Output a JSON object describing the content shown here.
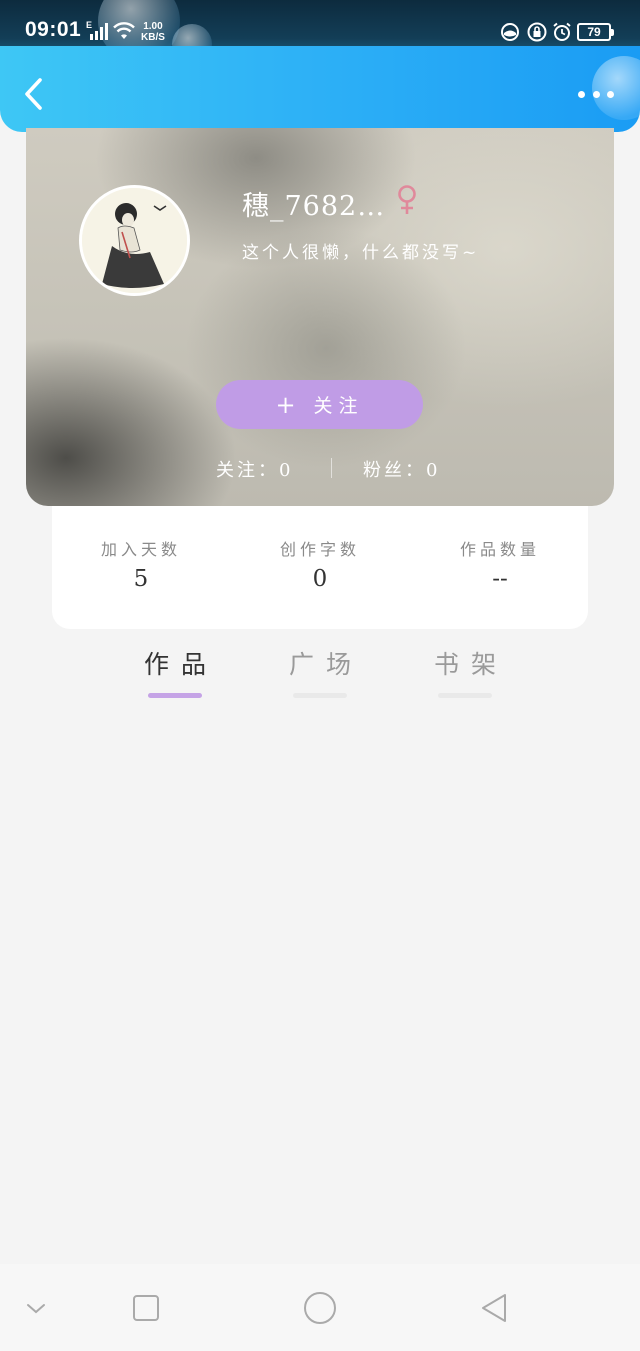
{
  "status_bar": {
    "time": "09:01",
    "network_type": "E",
    "speed_value": "1.00",
    "speed_unit": "KB/S",
    "battery": "79",
    "icons": [
      "signal-icon",
      "wifi-icon",
      "vpn-icon",
      "lock-icon",
      "alarm-icon",
      "battery-icon"
    ]
  },
  "header": {
    "back_icon": "back-arrow-icon",
    "more_icon": "more-dots-icon",
    "gradient": [
      "#3ec7f5",
      "#1a9cf4"
    ]
  },
  "profile": {
    "username": "穗_7682…",
    "gender": "♀",
    "gender_color": "#e0899b",
    "bio": "这个人很懒，什么都没写~",
    "follow_button": {
      "plus": "+",
      "label": "关注"
    },
    "following": "关注：0",
    "fans": "粉丝：0",
    "accent": "#c09ce6"
  },
  "stats": [
    {
      "label": "加入天数",
      "value": "5"
    },
    {
      "label": "创作字数",
      "value": "0"
    },
    {
      "label": "作品数量",
      "value": "--"
    }
  ],
  "tabs": [
    {
      "label": "作品",
      "active": true
    },
    {
      "label": "广场",
      "active": false
    },
    {
      "label": "书架",
      "active": false
    }
  ],
  "nav_bar": {
    "buttons": [
      "collapse-icon",
      "recent-apps-icon",
      "home-icon",
      "back-triangle-icon"
    ]
  }
}
